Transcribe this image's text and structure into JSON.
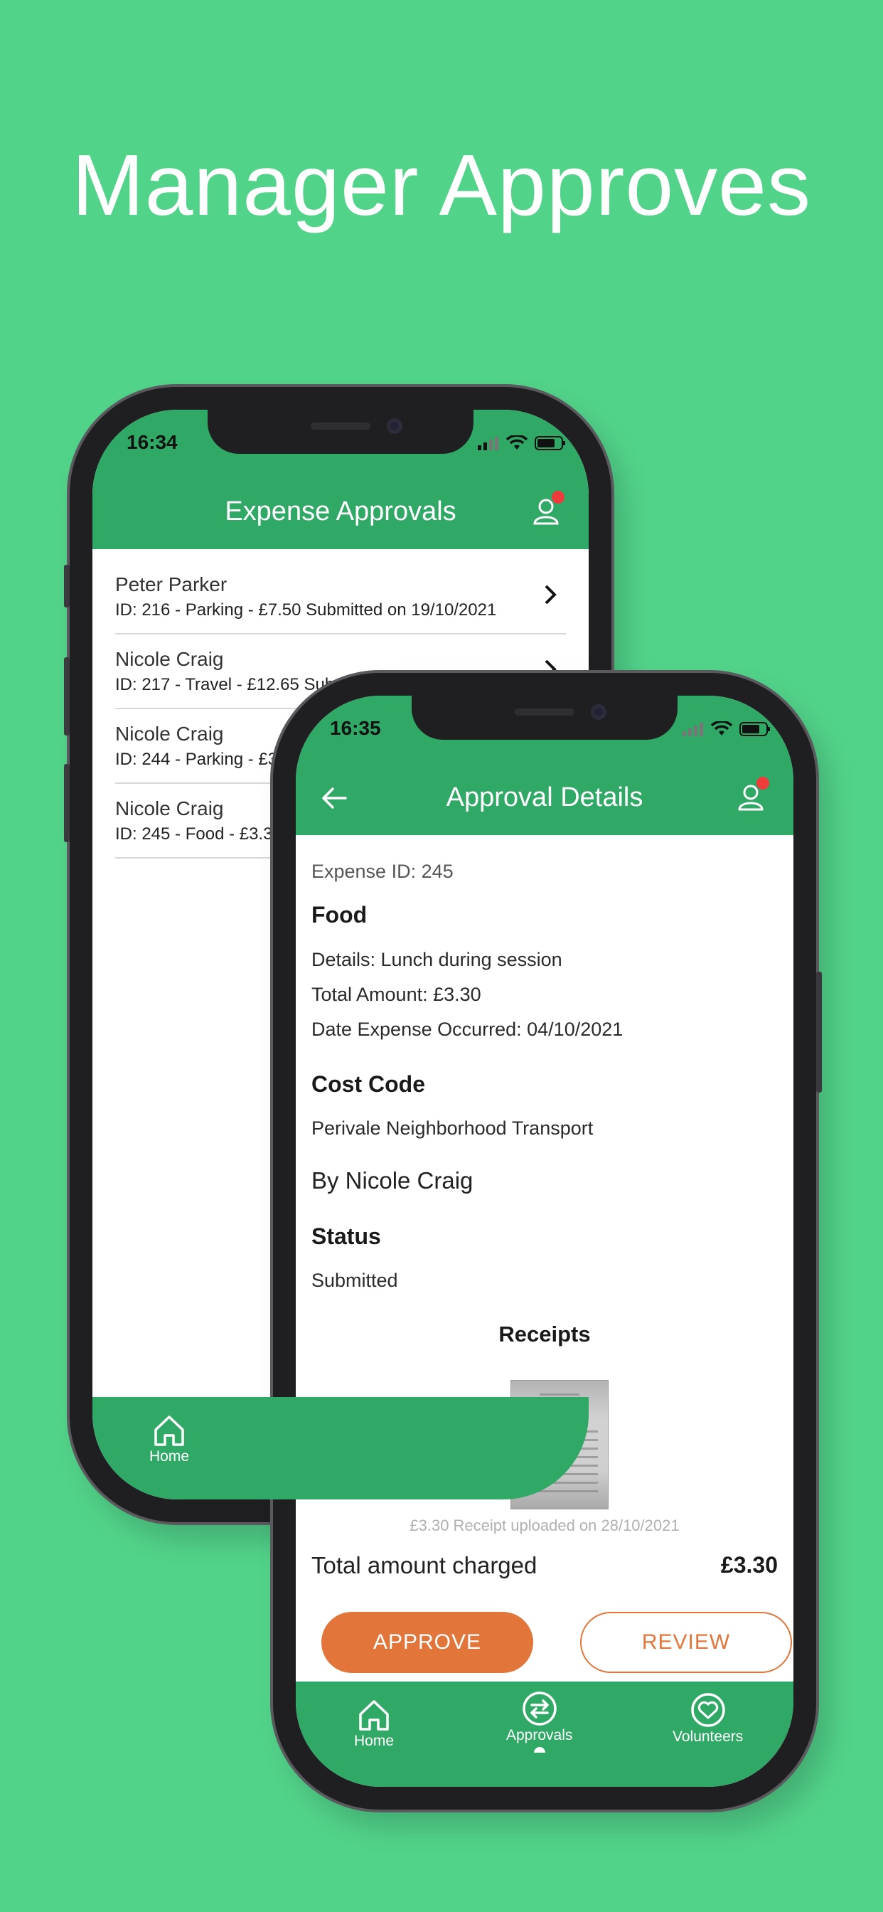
{
  "headline": "Manager Approves",
  "colors": {
    "background": "#52d38a",
    "app_green": "#2fa965",
    "accent_orange": "#e2763a",
    "badge_red": "#ef3b3b"
  },
  "list_screen": {
    "status_time": "16:34",
    "title": "Expense Approvals",
    "items": [
      {
        "name": "Peter Parker",
        "details": "ID: 216 - Parking - £7.50 Submitted on 19/10/2021"
      },
      {
        "name": "Nicole Craig",
        "details": "ID: 217 - Travel - £12.65 Submitted on 19/10/2021"
      },
      {
        "name": "Nicole Craig",
        "details": "ID: 244 - Parking - £3.00 Submitted on 04/10/2021"
      },
      {
        "name": "Nicole Craig",
        "details": "ID: 245 - Food - £3.30 Submitted on 28/10/2021"
      }
    ],
    "nav": {
      "home_label": "Home"
    }
  },
  "detail_screen": {
    "status_time": "16:35",
    "title": "Approval Details",
    "expense_id": "Expense ID: 245",
    "category": "Food",
    "details": "Details: Lunch during session",
    "total_amount": "Total Amount: £3.30",
    "date_occurred": "Date Expense Occurred: 04/10/2021",
    "cost_code_heading": "Cost Code",
    "cost_code": "Perivale Neighborhood Transport",
    "submitted_by": "By Nicole Craig",
    "status_heading": "Status",
    "status": "Submitted",
    "receipts_heading": "Receipts",
    "receipt_caption": "£3.30 Receipt uploaded on 28/10/2021",
    "total_charged_label": "Total amount charged",
    "total_charged_value": "£3.30",
    "approve_label": "APPROVE",
    "review_label": "REVIEW",
    "nav": {
      "home_label": "Home",
      "approvals_label": "Approvals",
      "volunteers_label": "Volunteers"
    }
  },
  "icons": [
    "home-icon",
    "approvals-icon",
    "volunteers-icon",
    "user-icon",
    "back-arrow-icon",
    "chevron-right-icon",
    "signal-icon",
    "wifi-icon",
    "battery-icon"
  ]
}
